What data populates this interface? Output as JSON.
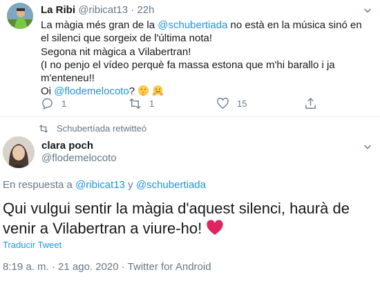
{
  "tweet1": {
    "author_name": "La Ribi",
    "author_handle": "@ribicat13",
    "separator": "·",
    "time": "22h",
    "line1_pre": "La màgia més gran de la ",
    "line1_mention": "@schubertiada",
    "line1_post": " no està en la música sinó en el silenci que sorgeix de l'última nota!",
    "line2": "Segona nit màgica a Vilabertran!",
    "line3": "(I no penjo el vídeo perquè fa massa estona que m'hi barallo i ja m'enteneu!!",
    "line4_pre": "Oi ",
    "line4_mention": "@flodemelocoto",
    "line4_post": "?",
    "reply_count": "1",
    "retweet_count": "1",
    "like_count": "15"
  },
  "retweet_notice": "Schubertíada retwitteó",
  "tweet2": {
    "author_name": "clara poch",
    "author_handle": "@flodemelocoto",
    "reply_prefix": "En respuesta a ",
    "reply_mention1": "@ribicat13",
    "reply_and": " y ",
    "reply_mention2": "@schubertiada",
    "text": "Qui vulgui sentir la màgia d'aquest silenci, haurà de venir a Vilabertran a viure-ho! ",
    "translate": "Traducir Tweet",
    "meta": "8:19 a. m. · 21 ago. 2020 · Twitter for Android"
  },
  "colors": {
    "link": "#1b95e0",
    "secondary_text": "#657786",
    "heart": "#e0245e"
  }
}
